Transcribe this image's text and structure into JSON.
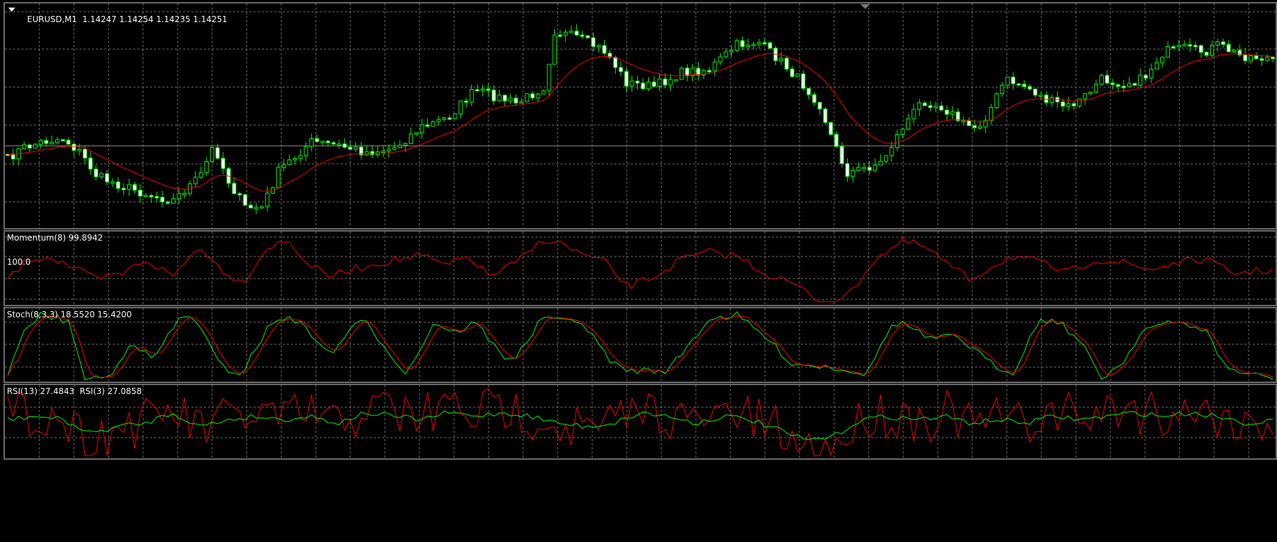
{
  "main": {
    "symbol": "EURUSD,M1",
    "quote": "1.14247 1.14254 1.14235 1.14251",
    "colors": {
      "up": "#00ff00",
      "body_up": "#000000",
      "body_down": "#ffffff",
      "ma": "#ff0000",
      "grid": "#777777",
      "bid_line": "#9a9a9a"
    },
    "icons": [
      "menu-triangle-icon",
      "chart-shift-marker-icon"
    ]
  },
  "momentum": {
    "label": "Momentum(8) 99.8942",
    "level_label": "100.0",
    "colors": {
      "line": "#ff0000"
    }
  },
  "stoch": {
    "label": "Stoch(8,3,3) 18.5520 15.4200",
    "colors": {
      "main": "#00ff00",
      "signal": "#ff0000"
    }
  },
  "rsi": {
    "label": "RSI(13) 27.4843  RSI(3) 27.0858",
    "colors": {
      "rsi13": "#00ff00",
      "rsi3": "#ff0000"
    }
  }
}
